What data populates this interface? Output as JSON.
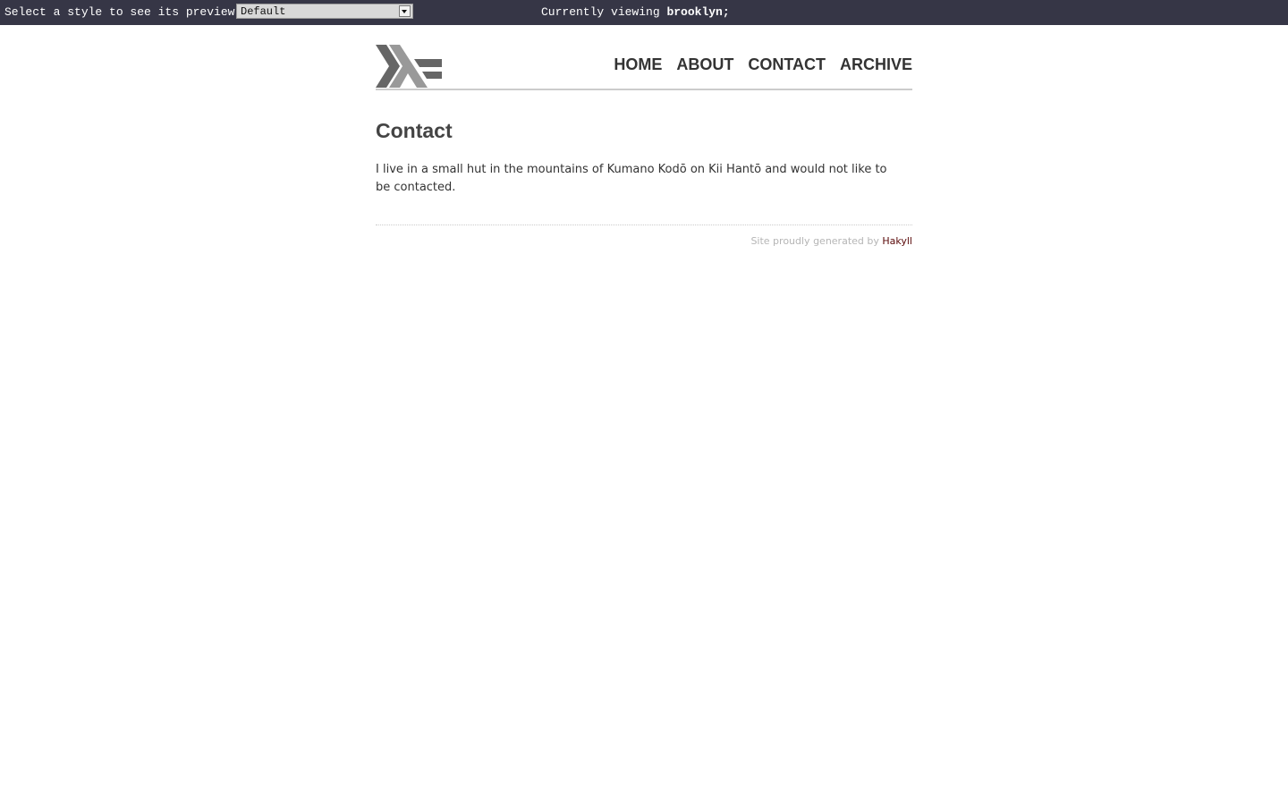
{
  "preview_bar": {
    "label": "Select a style to see its preview:",
    "selected_style": "Default",
    "viewing_prefix": "Currently viewing",
    "viewing_name": "brooklyn;"
  },
  "header": {
    "logo_icon": "haskell-logo-icon",
    "nav": [
      {
        "label": "HOME"
      },
      {
        "label": "ABOUT"
      },
      {
        "label": "CONTACT"
      },
      {
        "label": "ARCHIVE"
      }
    ]
  },
  "content": {
    "title": "Contact",
    "body": "I live in a small hut in the mountains of Kumano Kodō on Kii Hantō and would not like to be contacted."
  },
  "footer": {
    "text": "Site proudly generated by",
    "link_label": "Hakyll"
  },
  "colors": {
    "preview_bar_bg": "#363646",
    "nav_text": "#333333",
    "footer_link": "#5a0a0a",
    "logo_dark": "#666666",
    "logo_light": "#999999"
  }
}
